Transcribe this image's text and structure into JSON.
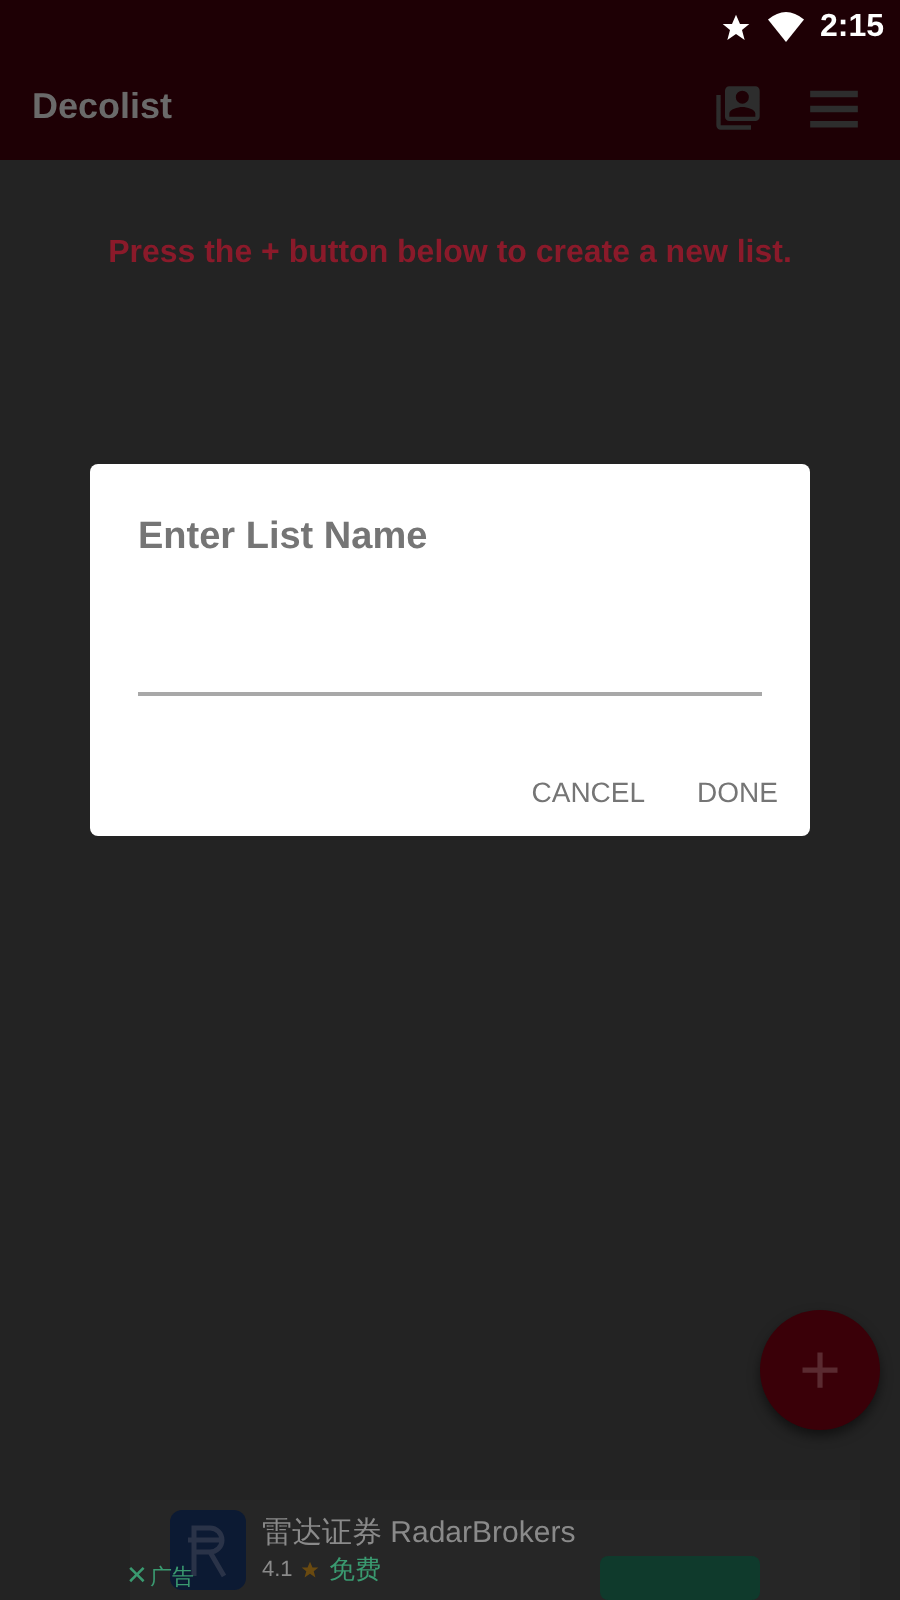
{
  "status_bar": {
    "time": "2:15"
  },
  "app_bar": {
    "title": "Decolist"
  },
  "empty_message": "Press the + button below to create a new list.",
  "dialog": {
    "title": "Enter List Name",
    "buttons": [
      "CANCEL",
      "DONE"
    ]
  },
  "fab": {
    "label": "+"
  },
  "ad": {
    "title": "雷达证券 RadarBrokers",
    "rating": "4.1",
    "price": "免费",
    "close": "✕",
    "label": "广告"
  }
}
